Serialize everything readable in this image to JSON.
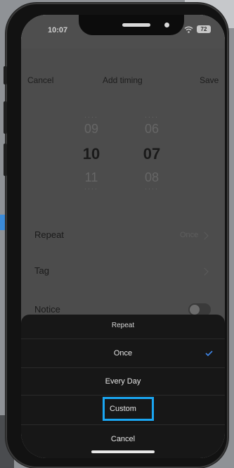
{
  "status_bar": {
    "time": "10:07",
    "battery": "72"
  },
  "header": {
    "cancel_label": "Cancel",
    "title": "Add timing",
    "save_label": "Save"
  },
  "time_picker": {
    "hours": {
      "above": "09",
      "selected": "10",
      "below": "11"
    },
    "minutes": {
      "above": "06",
      "selected": "07",
      "below": "08"
    }
  },
  "rows": {
    "repeat": {
      "label": "Repeat",
      "value": "Once"
    },
    "tag": {
      "label": "Tag"
    },
    "notice": {
      "label": "Notice",
      "enabled": false
    }
  },
  "sheet": {
    "title": "Repeat",
    "options": [
      {
        "label": "Once",
        "selected": true
      },
      {
        "label": "Every Day",
        "selected": false
      },
      {
        "label": "Custom",
        "selected": false,
        "highlighted": true
      }
    ],
    "cancel_label": "Cancel"
  },
  "colors": {
    "highlight": "#1aa6f2",
    "check": "#3f86e8",
    "accent_blue": "#3b8ad8"
  },
  "icons": [
    "wifi-icon",
    "battery-icon",
    "chevron-right-icon",
    "checkmark-icon"
  ]
}
